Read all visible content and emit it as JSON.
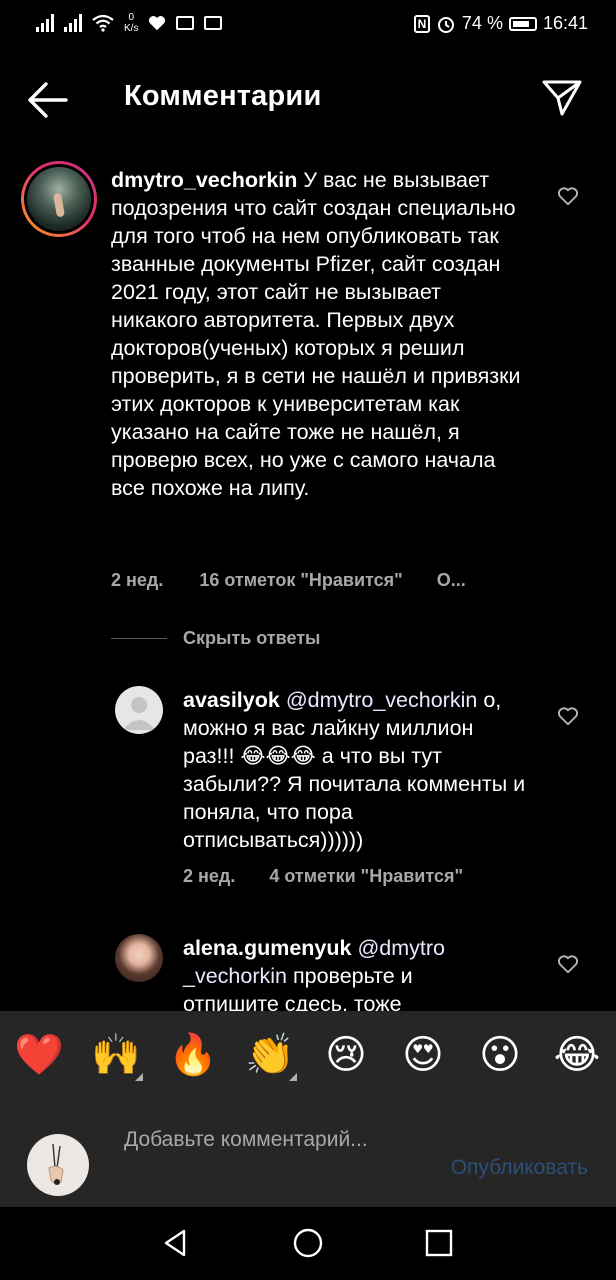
{
  "status_bar": {
    "speed_value": "0",
    "speed_unit": "K/s",
    "battery": "74 %",
    "time": "16:41"
  },
  "header": {
    "title": "Комментарии"
  },
  "comments": [
    {
      "username": "dmytro_vechorkin",
      "text": "У вас не вызывает подозрения что сайт создан специально для того чтоб на нем опубликовать так званные документы Pfizer, сайт создан 2021 году, этот сайт не вызывает никакого авторитета. Первых двух докторов(ученых) которых я решил проверить, я в сети не нашёл и привязки этих докторов к университетам как указано на сайте тоже не нашёл, я проверю всех, но уже с самого начала все похоже на липу.",
      "time": "2 нед.",
      "likes": "16 отметок \"Нравится\"",
      "reply": "О..."
    }
  ],
  "hide_replies": "Скрыть ответы",
  "replies": [
    {
      "username": "avasilyok",
      "mention": "@dmytro_vechorkin",
      "text": "о, можно я вас лайкну миллион раз!!! 😂😂😂 а что вы тут забыли?? Я почитала комменты и поняла, что пора отписываться))))))",
      "time": "2 нед.",
      "likes": "4 отметки \"Нравится\""
    },
    {
      "username": "alena.gumenyuk",
      "mention": "@dmytro _vechorkin",
      "text": "проверьте и отпишите сдесь, тоже"
    }
  ],
  "emoji_bar": [
    "❤️",
    "🙌",
    "🔥",
    "👏",
    "😢",
    "😍",
    "😮",
    "😂"
  ],
  "compose": {
    "placeholder": "Добавьте комментарий...",
    "publish": "Опубликовать"
  }
}
